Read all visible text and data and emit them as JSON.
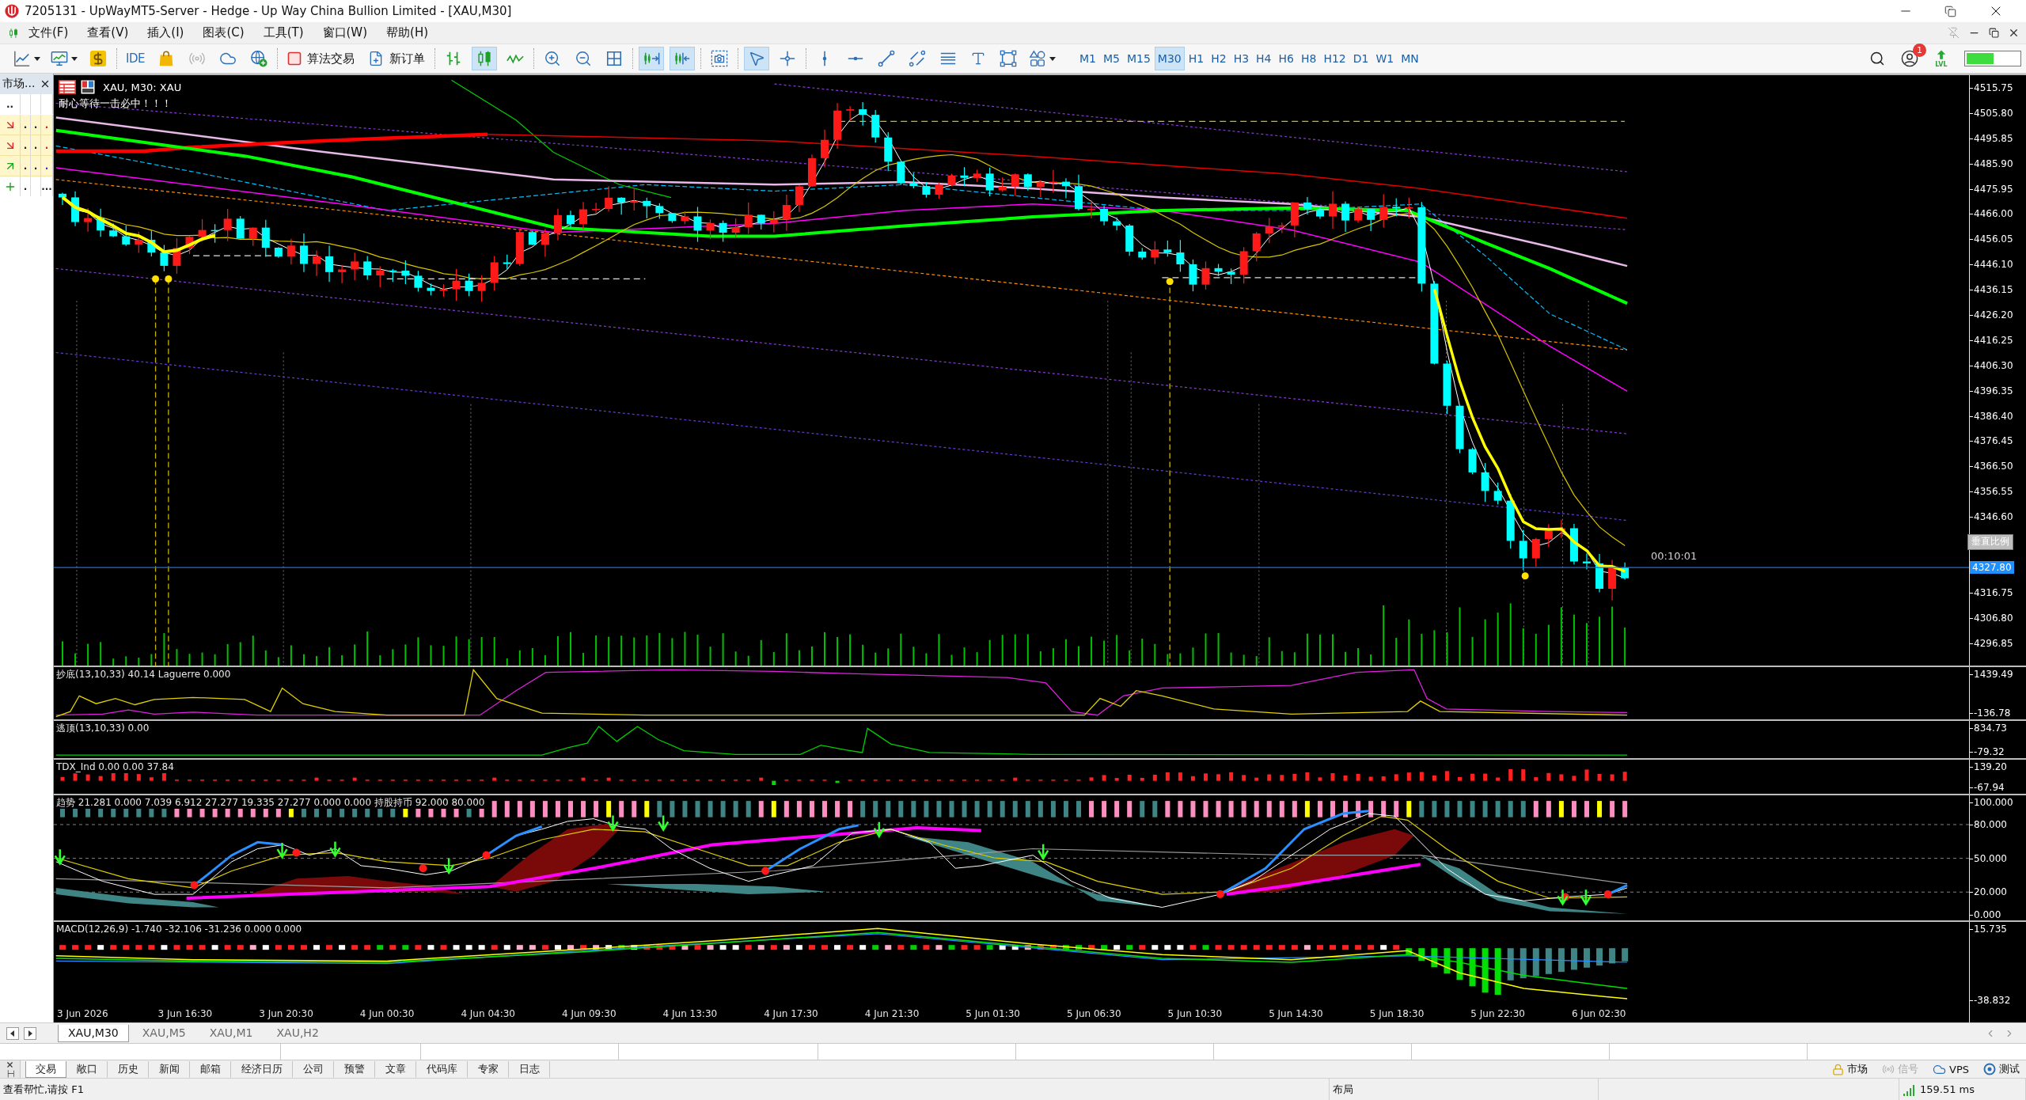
{
  "window": {
    "title": "7205131 - UpWayMT5-Server - Hedge - Up Way China Bullion Limited - [XAU,M30]"
  },
  "menu_bar": {
    "items": [
      "文件(F)",
      "查看(V)",
      "插入(I)",
      "图表(C)",
      "工具(T)",
      "窗口(W)",
      "帮助(H)"
    ]
  },
  "toolbar": {
    "ide_label": "IDE",
    "algo_trading": {
      "label": "算法交易",
      "on": false
    },
    "new_order": {
      "label": "新订单"
    },
    "chart_types": [
      {
        "selected": false
      },
      {
        "selected": true
      },
      {
        "selected": false
      }
    ],
    "auto_scroll": {
      "on": true
    },
    "chart_shift": {
      "on": true
    },
    "pointer_tools": [
      {
        "selected": true
      },
      {
        "selected": false
      }
    ],
    "timeframes": [
      {
        "label": "M1",
        "selected": false
      },
      {
        "label": "M5",
        "selected": false
      },
      {
        "label": "M15",
        "selected": false
      },
      {
        "label": "M30",
        "selected": true
      },
      {
        "label": "H1",
        "selected": false
      },
      {
        "label": "H2",
        "selected": false
      },
      {
        "label": "H3",
        "selected": false
      },
      {
        "label": "H4",
        "selected": false
      },
      {
        "label": "H6",
        "selected": false
      },
      {
        "label": "H8",
        "selected": false
      },
      {
        "label": "H12",
        "selected": false
      },
      {
        "label": "D1",
        "selected": false
      },
      {
        "label": "W1",
        "selected": false
      },
      {
        "label": "MN",
        "selected": false
      }
    ],
    "notifications": {
      "count": "1"
    },
    "lvl_label": "LVL"
  },
  "market_watch": {
    "title": "市场...",
    "header_cell": "..",
    "rows": [
      {
        "kind": "down",
        "cells": [
          ".",
          ".",
          "."
        ]
      },
      {
        "kind": "down",
        "cells": [
          ".",
          ".",
          "."
        ]
      },
      {
        "kind": "up",
        "cells": [
          ".",
          ".",
          "."
        ]
      }
    ],
    "add_row_cells": [
      ".",
      "..."
    ]
  },
  "chart": {
    "symbol_label": "XAU, M30: XAU",
    "comment": "耐心等待一击必中！！！",
    "countdown": "00:10:01",
    "price_axis": [
      {
        "kind": "tick",
        "label": "4515.75"
      },
      {
        "kind": "tick",
        "label": "4505.80"
      },
      {
        "kind": "tick",
        "label": "4495.85"
      },
      {
        "kind": "tick",
        "label": "4485.90"
      },
      {
        "kind": "tick",
        "label": "4475.95"
      },
      {
        "kind": "tick",
        "label": "4466.00"
      },
      {
        "kind": "tick",
        "label": "4456.05"
      },
      {
        "kind": "tick",
        "label": "4446.10"
      },
      {
        "kind": "tick",
        "label": "4436.15"
      },
      {
        "kind": "tick",
        "label": "4426.20"
      },
      {
        "kind": "tick",
        "label": "4416.25"
      },
      {
        "kind": "tick",
        "label": "4406.30"
      },
      {
        "kind": "tick",
        "label": "4396.35"
      },
      {
        "kind": "tick",
        "label": "4386.40"
      },
      {
        "kind": "tick",
        "label": "4376.45"
      },
      {
        "kind": "tick",
        "label": "4366.50"
      },
      {
        "kind": "tick",
        "label": "4356.55"
      },
      {
        "kind": "tick",
        "label": "4346.60"
      },
      {
        "kind": "scale_button",
        "label": "垂直比例"
      },
      {
        "kind": "price_tag",
        "label": "4327.80"
      },
      {
        "kind": "tick",
        "label": "4316.75"
      },
      {
        "kind": "tick",
        "label": "4306.80"
      },
      {
        "kind": "tick",
        "label": "4296.85"
      }
    ],
    "indicators": [
      {
        "kind": "laguerre",
        "label": "抄底(13,10,33) 40.14 Laguerre 0.000",
        "axis": [
          "1439.49",
          "-136.78"
        ]
      },
      {
        "kind": "escape",
        "label": "逃顶(13,10,33) 0.00",
        "axis": [
          "834.73",
          "-79.32"
        ]
      },
      {
        "kind": "tdx",
        "label": "TDX_Ind 0.00 0.00 37.84",
        "axis": [
          "139.20",
          "-67.94"
        ]
      },
      {
        "kind": "trend",
        "label": "趋势 21.281 0.000 7.039 6.912 27.277 19.335 27.277 0.000 0.000 持股持币 92.000 80.000",
        "axis": [
          "100.000",
          "80.000",
          "50.000",
          "20.000",
          "0.000"
        ]
      },
      {
        "kind": "macd",
        "label": "MACD(12,26,9) -1.740 -32.106 -31.236 0.000 0.000",
        "axis": [
          "15.735",
          "-38.832"
        ]
      }
    ],
    "time_axis": [
      "3 Jun 2026",
      "3 Jun 16:30",
      "3 Jun 20:30",
      "4 Jun 00:30",
      "4 Jun 04:30",
      "4 Jun 09:30",
      "4 Jun 13:30",
      "4 Jun 17:30",
      "4 Jun 21:30",
      "5 Jun 01:30",
      "5 Jun 06:30",
      "5 Jun 10:30",
      "5 Jun 14:30",
      "5 Jun 18:30",
      "5 Jun 22:30",
      "6 Jun 02:30"
    ]
  },
  "chart_tabs": [
    {
      "label": "XAU,M30",
      "selected": true
    },
    {
      "label": "XAU,M5",
      "selected": false
    },
    {
      "label": "XAU,M1",
      "selected": false
    },
    {
      "label": "XAU,H2",
      "selected": false
    }
  ],
  "toolbox": {
    "side_label": "工",
    "tabs": [
      {
        "label": "交易",
        "selected": true
      },
      {
        "label": "敞口",
        "selected": false
      },
      {
        "label": "历史",
        "selected": false
      },
      {
        "label": "新闻",
        "selected": false
      },
      {
        "label": "邮箱",
        "selected": false
      },
      {
        "label": "经济日历",
        "selected": false
      },
      {
        "label": "公司",
        "selected": false
      },
      {
        "label": "预警",
        "selected": false
      },
      {
        "label": "文章",
        "selected": false
      },
      {
        "label": "代码库",
        "selected": false
      },
      {
        "label": "专家",
        "selected": false
      },
      {
        "label": "日志",
        "selected": false
      }
    ],
    "status_items": [
      {
        "kind": "market",
        "label": "市场",
        "disabled": false
      },
      {
        "kind": "signals",
        "label": "信号",
        "disabled": true
      },
      {
        "kind": "vps",
        "label": "VPS",
        "disabled": false
      },
      {
        "kind": "tester",
        "label": "测试",
        "disabled": false
      }
    ]
  },
  "status_bar": {
    "help": "查看帮忙,请按 F1",
    "layout": "布局",
    "ping": "159.51 ms"
  }
}
